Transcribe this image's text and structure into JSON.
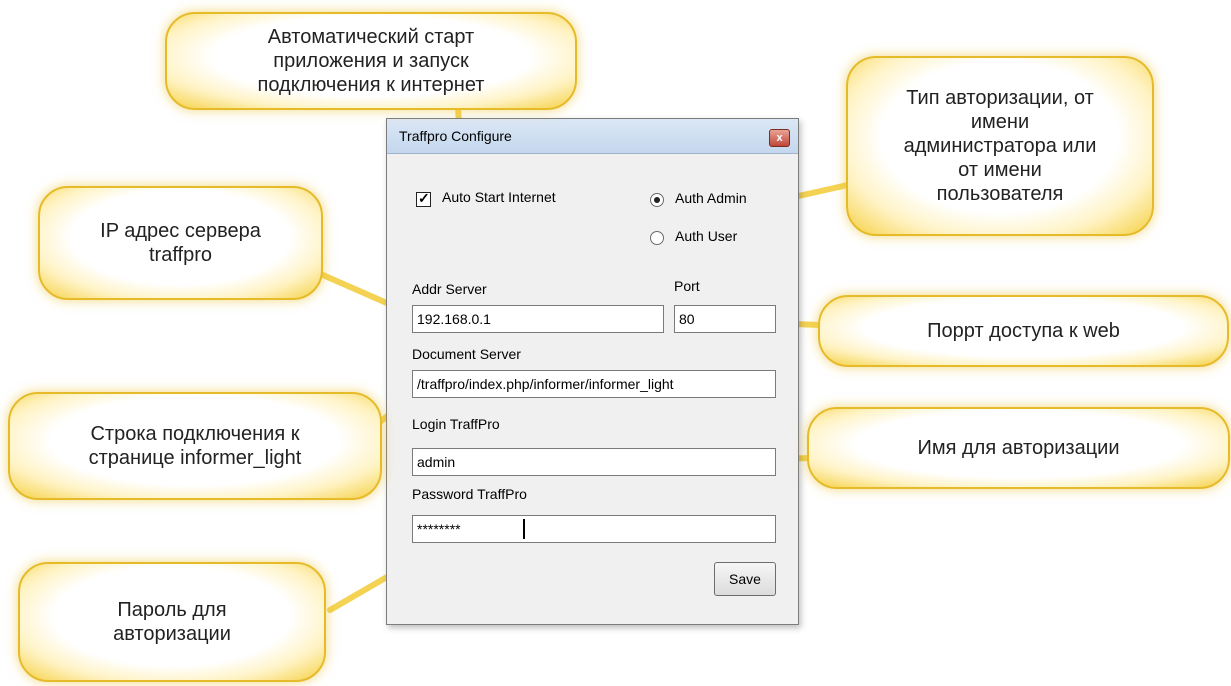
{
  "window": {
    "title": "Traffpro Configure",
    "close_glyph": "x",
    "auto_start_label": "Auto Start Internet",
    "auto_start_checked": true,
    "auth_admin_label": "Auth Admin",
    "auth_user_label": "Auth User",
    "auth_selected": "Auth Admin",
    "addr_server_label": "Addr Server",
    "addr_server_value": "192.168.0.1",
    "port_label": "Port",
    "port_value": "80",
    "document_server_label": "Document Server",
    "document_server_value": "/traffpro/index.php/informer/informer_light",
    "login_label": "Login TraffPro",
    "login_value": "admin",
    "password_label": "Password TraffPro",
    "password_value": "********",
    "save_label": "Save"
  },
  "callouts": {
    "autostart": "Автоматический старт\nприложения и запуск\nподключения к интернет",
    "auth_type": "Тип авторизации, от\nимени\nадминистратора или\nот имени\nпользователя",
    "ip": "IP адрес сервера\ntraffpro",
    "port": "Поррт доступа к web",
    "connection": "Строка подключения к\nстранице informer_light",
    "login": "Имя для авторизации",
    "password": "Пароль для\nавторизации"
  },
  "colors": {
    "callout_glow": "#f5d043",
    "callout_border": "#e6bb2a",
    "window_bg": "#f0f0f0",
    "titlebar": "#c4d7ee",
    "close_button": "#c0473a"
  }
}
